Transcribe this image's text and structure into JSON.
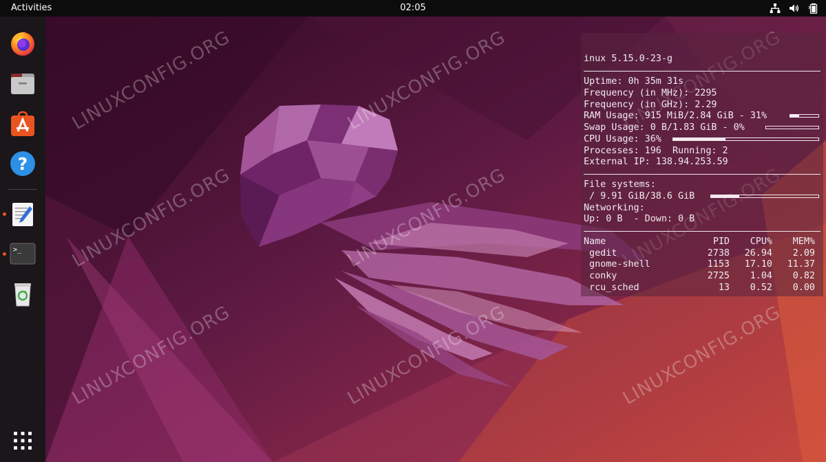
{
  "topbar": {
    "activities": "Activities",
    "clock": "02:05",
    "tray_icons": [
      "network-wired-icon",
      "volume-icon",
      "battery-icon"
    ]
  },
  "dock": {
    "apps": [
      {
        "name": "Firefox",
        "icon": "firefox-icon",
        "running": false
      },
      {
        "name": "Files",
        "icon": "files-icon",
        "running": false
      },
      {
        "name": "Ubuntu Software",
        "icon": "software-store-icon",
        "running": false
      },
      {
        "name": "Help",
        "icon": "help-icon",
        "running": false
      },
      {
        "name": "Text Editor",
        "icon": "text-editor-icon",
        "running": true
      },
      {
        "name": "Terminal",
        "icon": "terminal-icon",
        "running": true
      },
      {
        "name": "Trash",
        "icon": "trash-icon",
        "running": false
      }
    ],
    "show_apps_icon": "app-grid-icon",
    "accent": "#e95420"
  },
  "watermark": "LINUXCONFIG.ORG",
  "conky": {
    "kernel": "inux 5.15.0-23-g",
    "uptime": "Uptime: 0h 35m 31s",
    "freq_mhz": "Frequency (in MHz): 2295",
    "freq_ghz": "Frequency (in GHz): 2.29",
    "ram": {
      "text": "RAM Usage: 915 MiB/2.84 GiB - 31%",
      "percent": 31
    },
    "swap": {
      "text": "Swap Usage: 0 B/1.83 GiB - 0%",
      "percent": 0
    },
    "cpu": {
      "text": "CPU Usage: 36%",
      "percent": 36
    },
    "processes": "Processes: 196  Running: 2",
    "external_ip": "External IP: 138.94.253.59",
    "fs_header": "File systems:",
    "fs_root": {
      "text": " / 9.91 GiB/38.6 GiB",
      "percent": 26
    },
    "net_header": "Networking:",
    "net_line": "Up: 0 B  - Down: 0 B",
    "table": {
      "headers": [
        "Name",
        "PID",
        "CPU%",
        "MEM%"
      ],
      "rows": [
        [
          " gedit",
          "2738",
          "26.94",
          "2.09"
        ],
        [
          " gnome-shell",
          "1153",
          "17.10",
          "11.37"
        ],
        [
          " conky",
          "2725",
          "1.04",
          "0.82"
        ],
        [
          " rcu_sched",
          "13",
          "0.52",
          "0.00"
        ]
      ]
    }
  }
}
